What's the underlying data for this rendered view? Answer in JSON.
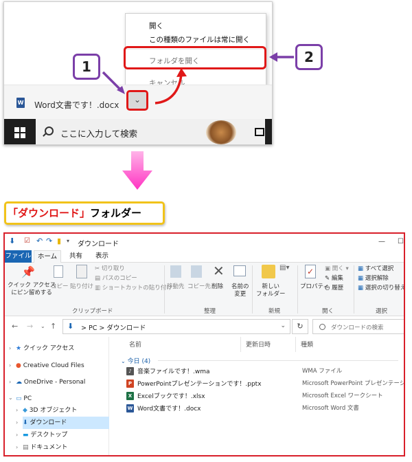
{
  "popup": {
    "menu_items": [
      "開く",
      "この種類のファイルは常に開く",
      "フォルダを開く",
      "キャンセル"
    ],
    "download_filename": "Word文書です！.docx",
    "search_placeholder": "ここに入力して検索",
    "step1": "1",
    "step2": "2"
  },
  "folder_label": {
    "open_bracket": "「",
    "name": "ダウンロード",
    "close_bracket": "」",
    "suffix": "フォルダー"
  },
  "explorer": {
    "title": "ダウンロード",
    "tabs": {
      "file": "ファイル",
      "home": "ホーム",
      "share": "共有",
      "view": "表示"
    },
    "ribbon": {
      "pin": [
        "クイック アクセス",
        "にピン留めする"
      ],
      "copy": "コピー",
      "paste": "貼り付け",
      "cut": "切り取り",
      "copy_path": "パスのコピー",
      "paste_shortcut": "ショートカットの貼り付け",
      "group_clipboard": "クリップボード",
      "move_to": "移動先",
      "copy_to": "コピー先",
      "delete": "削除",
      "rename": [
        "名前の",
        "変更"
      ],
      "group_organize": "整理",
      "new_folder": [
        "新しい",
        "フォルダー"
      ],
      "group_new": "新規",
      "properties": "プロパティ",
      "open": "開く",
      "edit": "編集",
      "history": "履歴",
      "group_open": "開く",
      "select_all": "すべて選択",
      "select_none": "選択解除",
      "invert_selection": "選択の切り替え",
      "group_select": "選択"
    },
    "address": {
      "pc": "PC",
      "sep": ">",
      "folder": "ダウンロード"
    },
    "search_placeholder": "ダウンロードの検索",
    "nav": [
      "クイック アクセス",
      "Creative Cloud Files",
      "OneDrive - Personal",
      "PC",
      "3D オブジェクト",
      "ダウンロード",
      "デスクトップ",
      "ドキュメント"
    ],
    "columns": {
      "name": "名前",
      "modified": "更新日時",
      "type": "種類"
    },
    "group": "今日 (4)",
    "files": [
      {
        "name": "音楽ファイルです！.wma",
        "type": "WMA ファイル",
        "icon": "wma-file-icon",
        "color": "#555555"
      },
      {
        "name": "PowerPointプレゼンテーションです！.pptx",
        "type": "Microsoft PowerPoint プレゼンテーション",
        "icon": "powerpoint-file-icon",
        "color": "#d04423"
      },
      {
        "name": "Excelブックです！.xlsx",
        "type": "Microsoft Excel ワークシート",
        "icon": "excel-file-icon",
        "color": "#1d7145"
      },
      {
        "name": "Word文書です！.docx",
        "type": "Microsoft Word 文書",
        "icon": "word-file-icon",
        "color": "#2b5797"
      }
    ]
  },
  "colors": {
    "highlight": "#e01818",
    "callout": "#7b3fa8",
    "arrow": "#ff49c8",
    "label_border": "#f1c31a",
    "explorer_border": "#d81f2a",
    "ribbon_file_tab": "#1a66b3"
  }
}
